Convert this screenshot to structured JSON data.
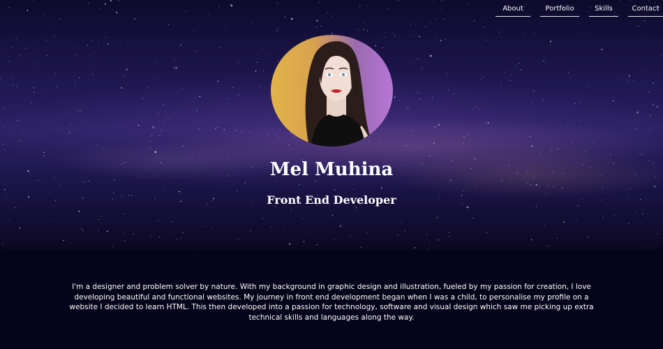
{
  "nav": {
    "items": [
      {
        "label": "About"
      },
      {
        "label": "Portfolio"
      },
      {
        "label": "Skills"
      },
      {
        "label": "Contact"
      }
    ]
  },
  "hero": {
    "name": "Mel Muhina",
    "role": "Front End Developer"
  },
  "about": {
    "text": "I'm a designer and problem solver by nature. With my background in graphic design and illustration, fueled by my passion for creation, I love developing beautiful and functional websites. My journey in front end development began when I was a child, to personalise my profile on a website I decided to learn HTML. This then developed into a passion for technology, software and visual design which saw me picking up extra technical skills and languages along the way."
  },
  "colors": {
    "page_background": "#05041a",
    "hero_sky": "#231a58",
    "text": "#ffffff",
    "avatar_left": "#e2b44a",
    "avatar_right": "#b877d6"
  }
}
